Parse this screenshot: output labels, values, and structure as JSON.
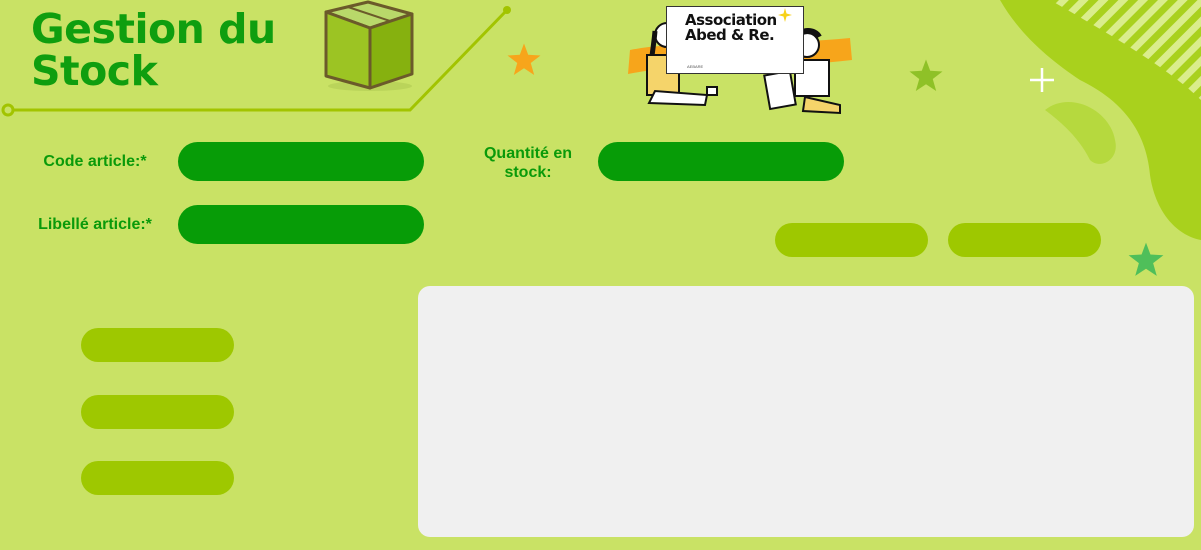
{
  "header": {
    "title": "Gestion du Stock"
  },
  "logo": {
    "name": "Association Abed & Re.",
    "sub": "AEBARE"
  },
  "form": {
    "code_label": "Code article:*",
    "code_value": "",
    "libelle_label": "Libellé article:*",
    "libelle_value": "",
    "quantite_label": "Quantité en stock:",
    "quantite_value": ""
  },
  "actions": {
    "top_buttons": [
      "",
      ""
    ],
    "side_buttons": [
      "",
      "",
      ""
    ]
  },
  "colors": {
    "background": "#c9e265",
    "field": "#079c07",
    "button": "#9ec800",
    "title": "#0f9e0f",
    "panel": "#f0f0f0",
    "accent_star_orange": "#f7a51b",
    "accent_star_green": "#5cc15a"
  },
  "icons": [
    "box-icon",
    "star-icon",
    "sparkle-icon"
  ]
}
